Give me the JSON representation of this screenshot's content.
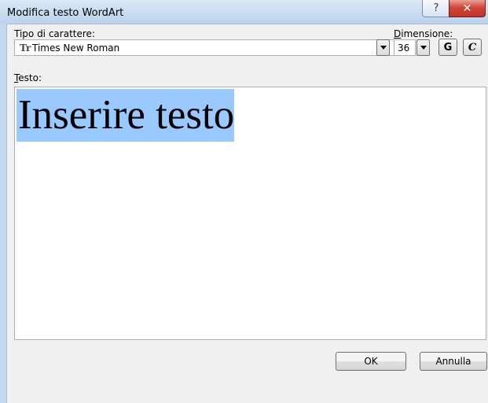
{
  "window": {
    "title": "Modifica testo WordArt",
    "help_glyph": "?",
    "close_glyph": "✕"
  },
  "font": {
    "label_pre": "Tipo di carattere:",
    "value": "Times New Roman",
    "icon": "truetype-font-icon",
    "icon_glyph": "Tr"
  },
  "size": {
    "label_first": "D",
    "label_rest": "imensione:",
    "value": "36"
  },
  "format": {
    "bold_label": "G",
    "italic_label": "C"
  },
  "text": {
    "label_first": "T",
    "label_rest": "esto:",
    "value": "Inserire testo",
    "selected": true,
    "selection_color": "#99c9ff"
  },
  "buttons": {
    "ok": "OK",
    "cancel": "Annulla"
  },
  "colors": {
    "close_button": "#c9392e",
    "titlebar": "#c9dcef"
  }
}
